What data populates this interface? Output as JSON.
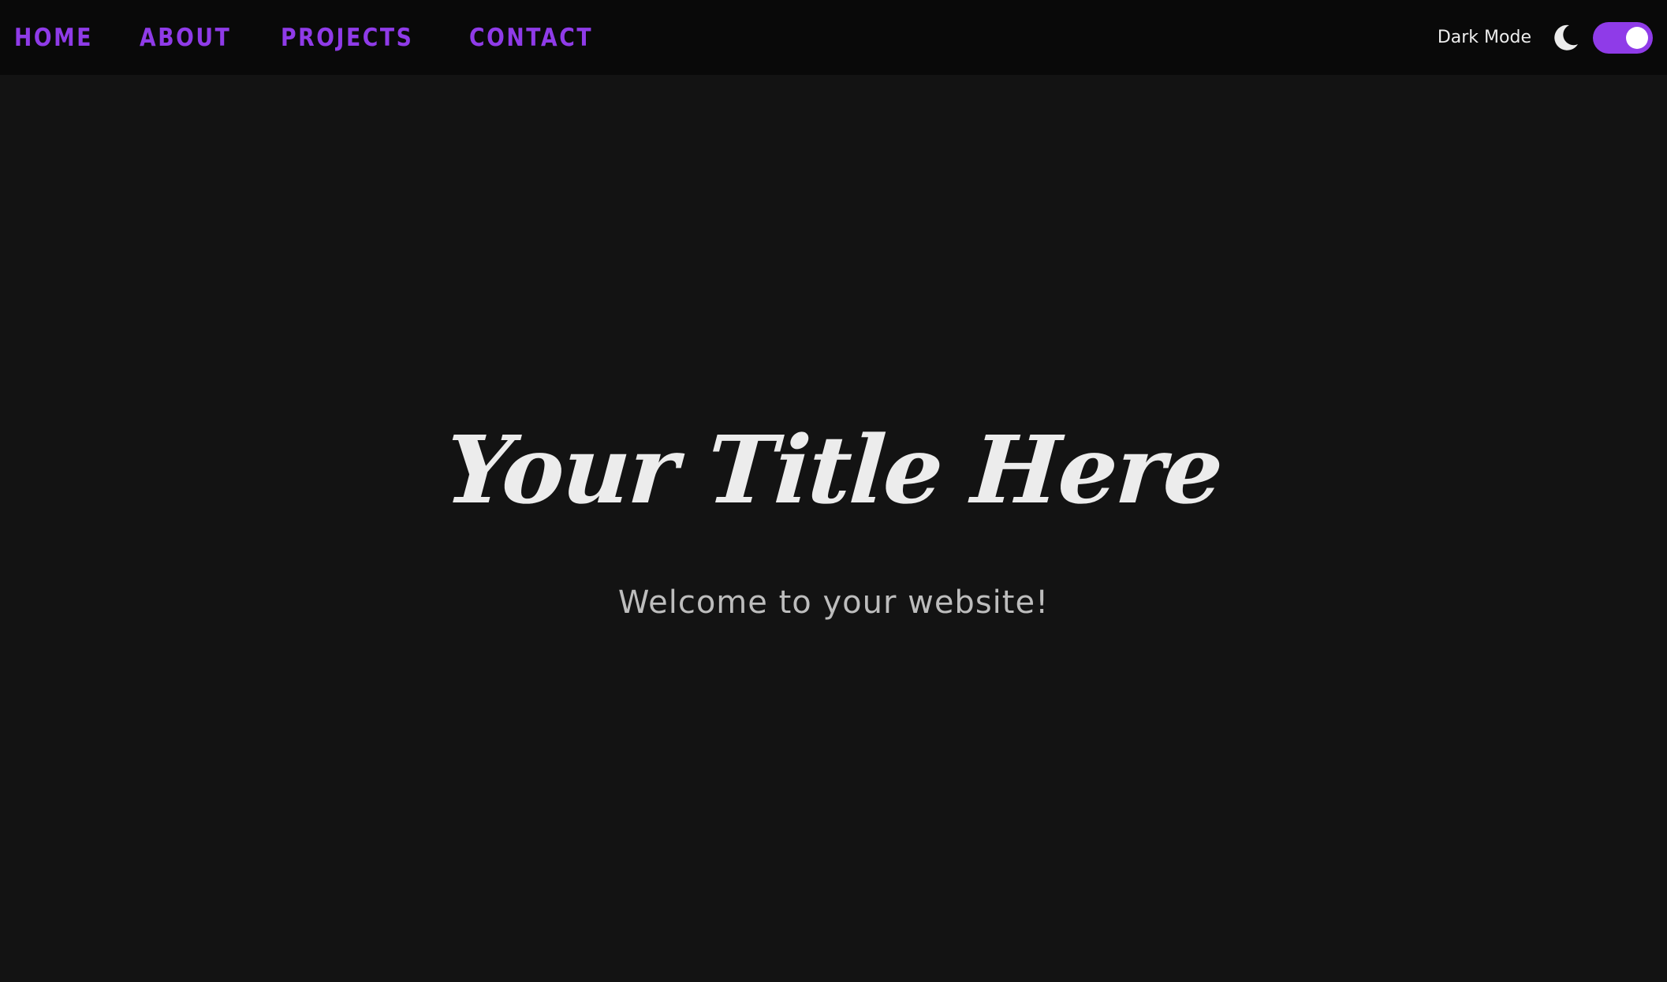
{
  "nav": {
    "links": [
      "HOME",
      "ABOUT",
      "PROJECTS",
      "CONTACT"
    ],
    "dark_mode_label": "Dark Mode",
    "dark_mode_enabled": true
  },
  "hero": {
    "title": "Your Title Here",
    "subtitle": "Welcome to your website!"
  },
  "colors": {
    "accent": "#8f3be8",
    "background": "#131313",
    "navbar": "#090909",
    "title_text": "#ececec",
    "subtitle_text": "#bdbdbd"
  },
  "icons": {
    "moon": "moon-icon"
  }
}
